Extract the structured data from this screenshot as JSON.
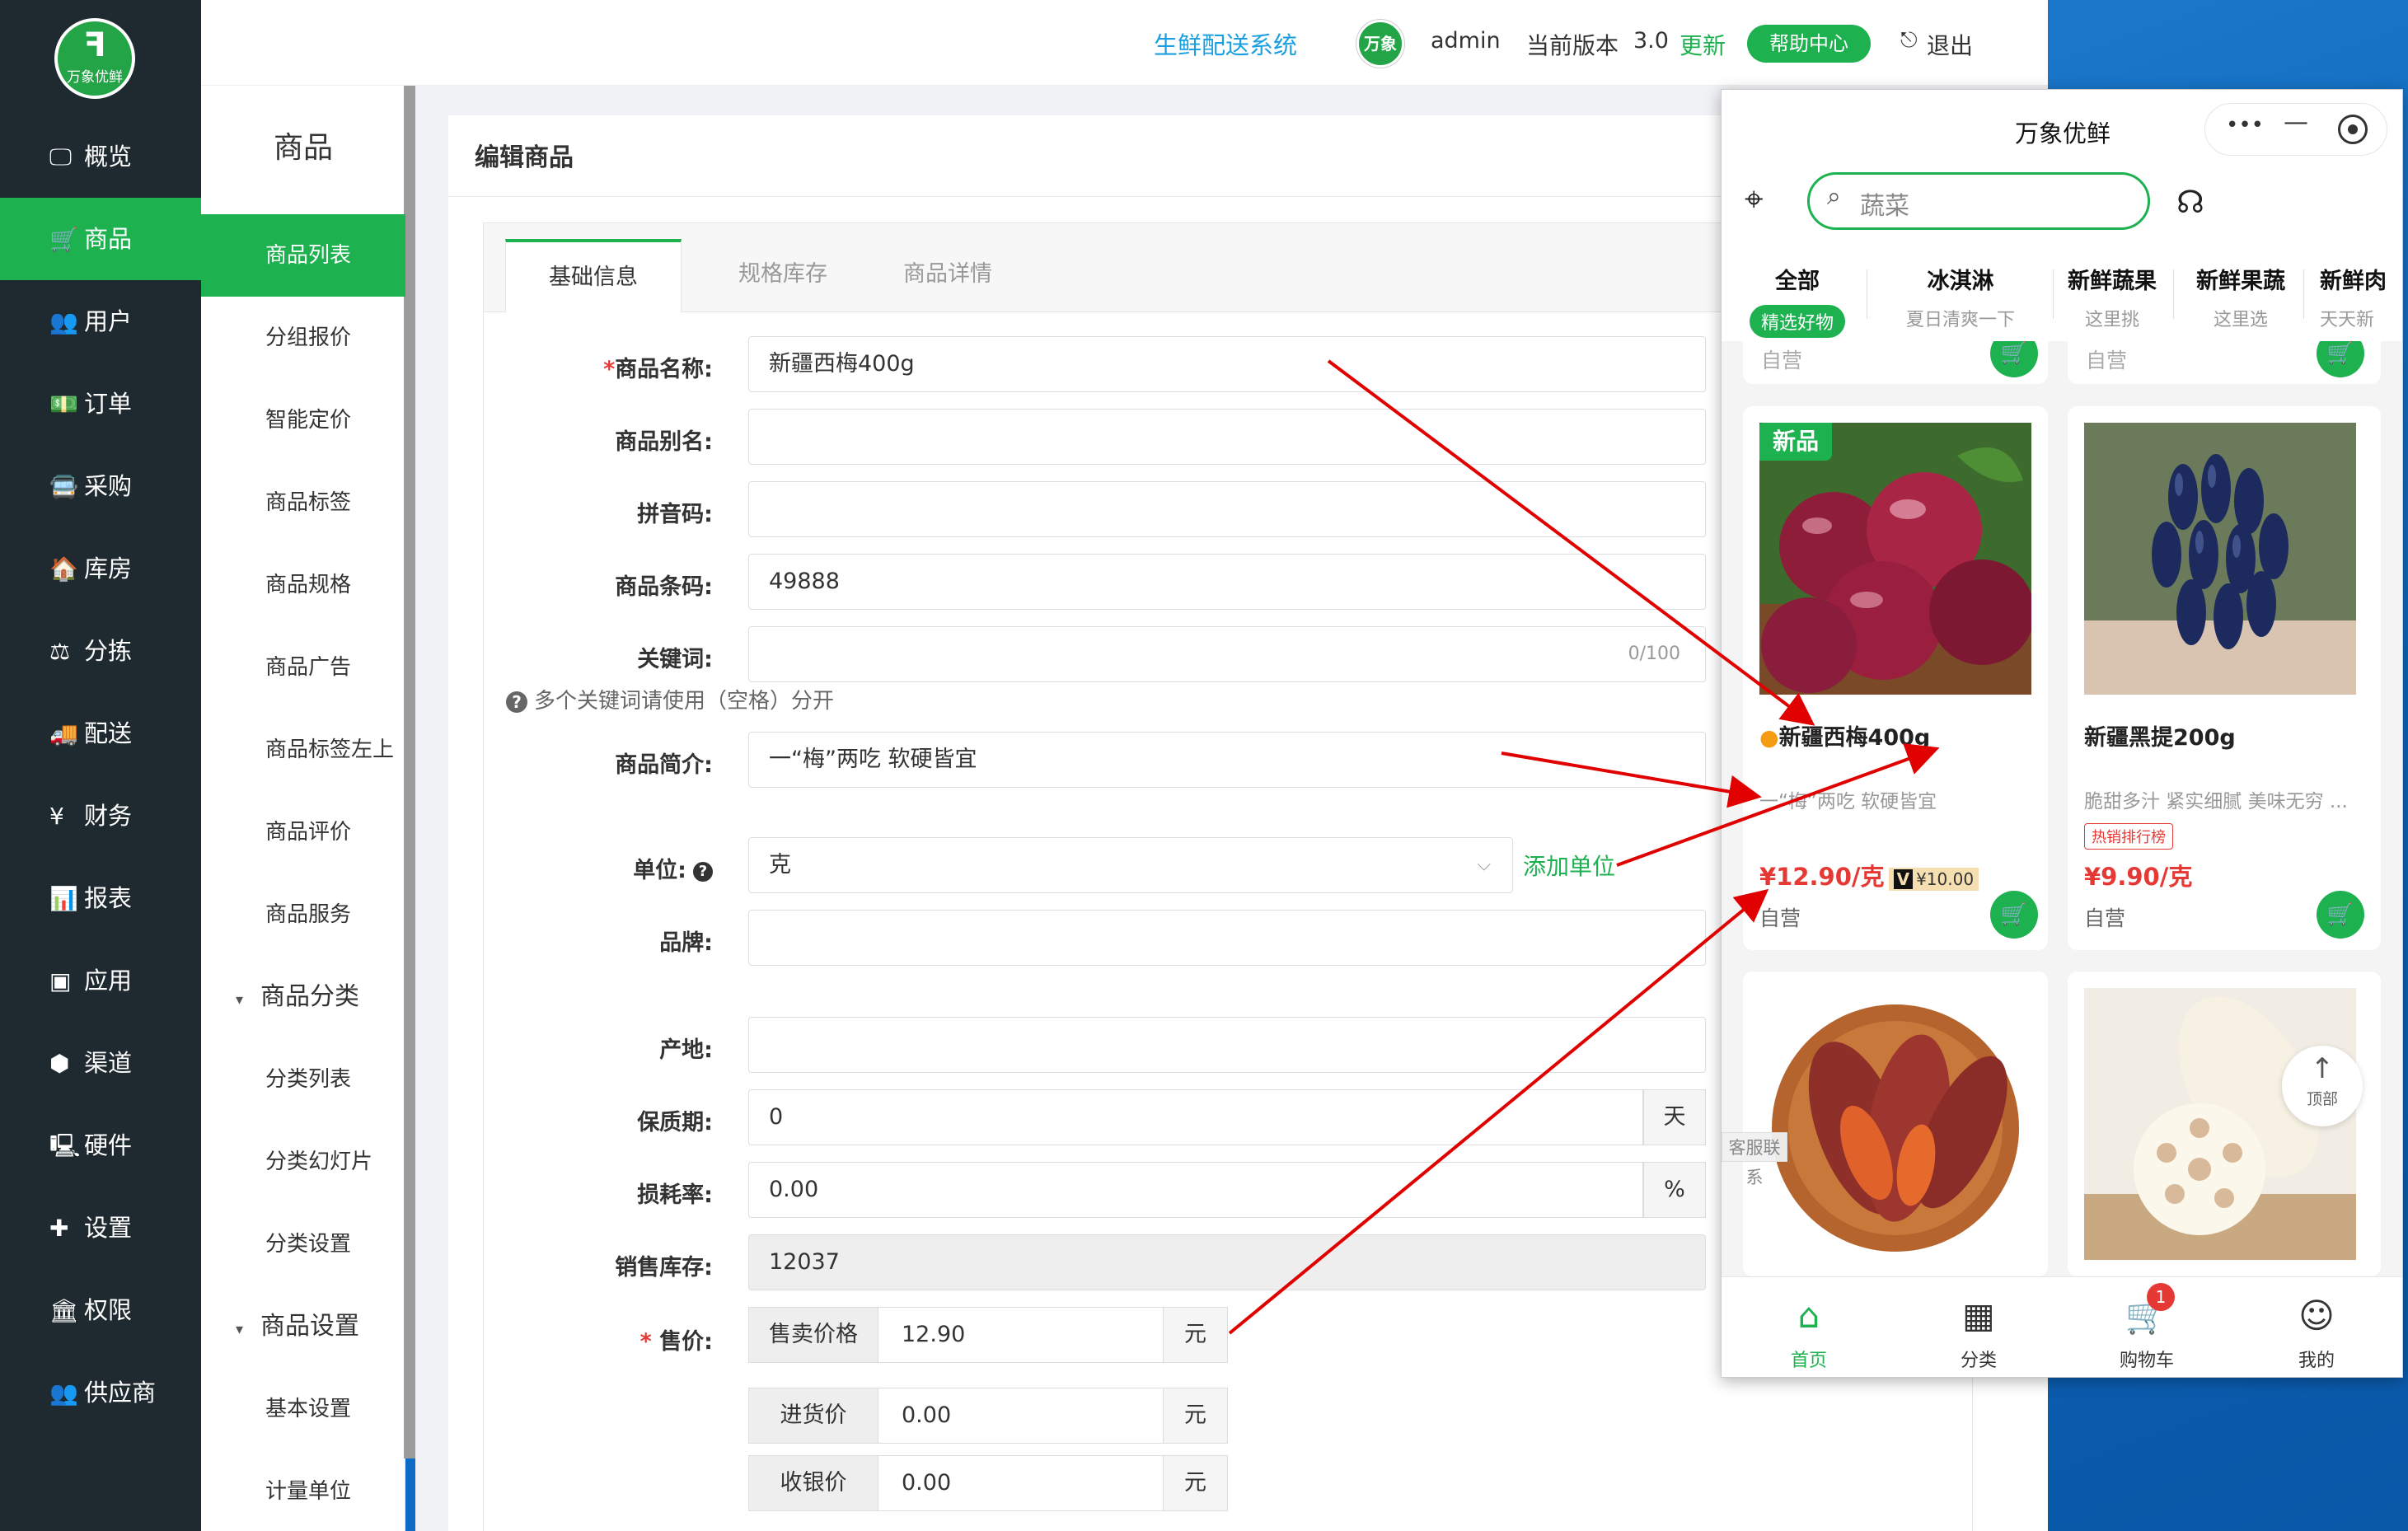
{
  "header": {
    "system_name": "生鲜配送系统",
    "avatar_text": "万象",
    "user": "admin",
    "version_label": "当前版本",
    "version": "3.0",
    "update": "更新",
    "help": "帮助中心",
    "logout": "退出"
  },
  "logo": {
    "glyph": "ꟻ",
    "text": "万象优鲜"
  },
  "sidebar": {
    "items": [
      {
        "label": "概览",
        "icon": "monitor-icon",
        "glyph": "🖵"
      },
      {
        "label": "商品",
        "icon": "cart-icon",
        "glyph": "🛒"
      },
      {
        "label": "用户",
        "icon": "users-icon",
        "glyph": "👥"
      },
      {
        "label": "订单",
        "icon": "money-icon",
        "glyph": "💵"
      },
      {
        "label": "采购",
        "icon": "bus-icon",
        "glyph": "🚍"
      },
      {
        "label": "库房",
        "icon": "home-icon",
        "glyph": "🏠"
      },
      {
        "label": "分拣",
        "icon": "scale-icon",
        "glyph": "⚖"
      },
      {
        "label": "配送",
        "icon": "truck-icon",
        "glyph": "🚚"
      },
      {
        "label": "财务",
        "icon": "yen-icon",
        "glyph": "¥"
      },
      {
        "label": "报表",
        "icon": "bar-chart-icon",
        "glyph": "📊"
      },
      {
        "label": "应用",
        "icon": "apps-icon",
        "glyph": "▣"
      },
      {
        "label": "渠道",
        "icon": "cube-icon",
        "glyph": "⬢"
      },
      {
        "label": "硬件",
        "icon": "desktop-icon",
        "glyph": "🖳"
      },
      {
        "label": "设置",
        "icon": "puzzle-icon",
        "glyph": "✚"
      },
      {
        "label": "权限",
        "icon": "bank-icon",
        "glyph": "🏛"
      },
      {
        "label": "供应商",
        "icon": "group-icon",
        "glyph": "👥"
      }
    ]
  },
  "submenu": {
    "title": "商品",
    "items": [
      "商品列表",
      "分组报价",
      "智能定价",
      "商品标签",
      "商品规格",
      "商品广告",
      "商品标签左上",
      "商品评价",
      "商品服务"
    ],
    "group1": "商品分类",
    "group1_items": [
      "分类列表",
      "分类幻灯片",
      "分类设置"
    ],
    "group2": "商品设置",
    "group2_items": [
      "基本设置",
      "计量单位"
    ]
  },
  "panel": {
    "title": "编辑商品",
    "tabs": [
      "基础信息",
      "规格库存",
      "商品详情"
    ]
  },
  "form": {
    "name_label": "商品名称:",
    "name_value": "新疆西梅400g",
    "alias_label": "商品别名:",
    "pinyin_label": "拼音码:",
    "barcode_label": "商品条码:",
    "barcode_value": "49888",
    "keywords_label": "关键词:",
    "keywords_counter": "0/100",
    "hint": "多个关键词请使用（空格）分开",
    "intro_label": "商品简介:",
    "intro_value": "一“梅”两吃 软硬皆宜",
    "unit_label": "单位:",
    "unit_value": "克",
    "add_unit": "添加单位",
    "brand_label": "品牌:",
    "origin_label": "产地:",
    "shelf_label": "保质期:",
    "shelf_value": "0",
    "shelf_unit": "天",
    "loss_label": "损耗率:",
    "loss_value": "0.00",
    "loss_unit": "%",
    "stock_label": "销售库存:",
    "stock_value": "12037",
    "price_label": "售价:",
    "sell_price_label": "售卖价格",
    "sell_price_value": "12.90",
    "purchase_price_label": "进货价",
    "purchase_price_value": "0.00",
    "cashier_price_label": "收银价",
    "cashier_price_value": "0.00",
    "currency": "元"
  },
  "phone": {
    "title": "万象优鲜",
    "more": "•••",
    "minimize": "—",
    "search_placeholder": "蔬菜",
    "categories": [
      {
        "title": "全部",
        "sub": "精选好物"
      },
      {
        "title": "冰淇淋",
        "sub": "夏日清爽一下"
      },
      {
        "title": "新鲜蔬果",
        "sub": "这里挑"
      },
      {
        "title": "新鲜果蔬",
        "sub": "这里选"
      },
      {
        "title": "新鲜肉",
        "sub": "天天新"
      }
    ],
    "top_cut_label": "自营",
    "products": [
      {
        "name": "新疆西梅400g",
        "desc": "一“梅”两吃 软硬皆宜",
        "price": "¥12.90/克",
        "vip_mark": "V",
        "vip_price": "¥10.00",
        "self": "自营",
        "tag": "新品"
      },
      {
        "name": "新疆黑提200g",
        "desc": "脆甜多汁 紧实细腻 美味无穷 ...",
        "price": "¥9.90/克",
        "hot": "热销排行榜",
        "self": "自营"
      }
    ],
    "service": "客服联系",
    "top_arrow": "↑",
    "top": "顶部",
    "tabbar": [
      {
        "label": "首页",
        "icon": "home-icon"
      },
      {
        "label": "分类",
        "icon": "grid-icon"
      },
      {
        "label": "购物车",
        "icon": "cart-icon"
      },
      {
        "label": "我的",
        "icon": "smile-icon"
      }
    ],
    "cart_count": "1"
  },
  "colors": {
    "brand_green": "#1db14f",
    "sidebar_dark": "#1f2a30",
    "price_red": "#e53935",
    "annotation_red": "#e00000"
  }
}
